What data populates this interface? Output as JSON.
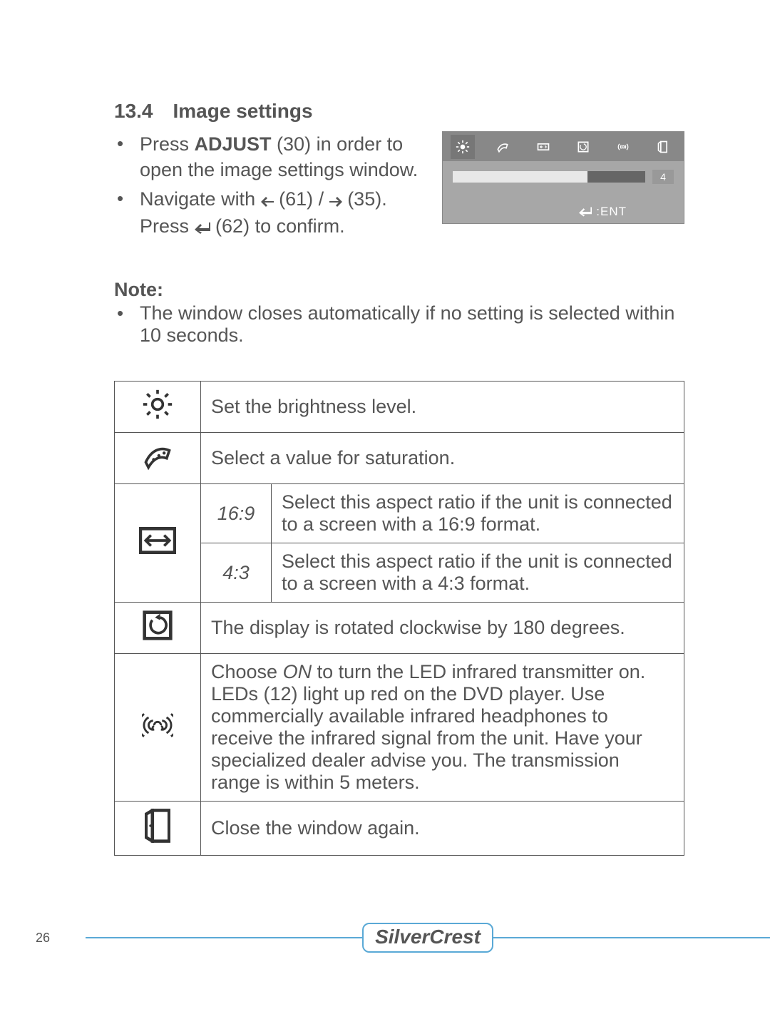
{
  "section": {
    "number": "13.4",
    "title": "Image settings"
  },
  "instructions": {
    "line1_pre": "Press ",
    "line1_bold": "ADJUST",
    "line1_post": " (30) in order to open the image settings window.",
    "line2_pre": "Navigate with ",
    "line2_mid1": " (61) ",
    "line2_slash": "/",
    "line2_mid2": " (35). Press ",
    "line2_post": " (62) to confirm."
  },
  "screenshot": {
    "value": "4",
    "footer_label": ":ENT"
  },
  "note": {
    "label": "Note:",
    "text": "The window closes automatically if no setting is selected within 10 seconds."
  },
  "table": {
    "brightness": "Set the brightness level.",
    "saturation": "Select a value for saturation.",
    "ratio_169_label": "16:9",
    "ratio_169_desc": "Select this aspect ratio if the unit is connected to a screen with a 16:9 format.",
    "ratio_43_label": "4:3",
    "ratio_43_desc": "Select this aspect ratio if the unit is connected to a screen with a 4:3 format.",
    "rotate": "The display is rotated clockwise by 180 degrees.",
    "ir_pre": "Choose ",
    "ir_on": "ON",
    "ir_post": " to turn the LED infrared transmitter on. LEDs (12) light up red on the DVD player. Use commercially available infrared headphones to receive the infrared signal from the unit. Have your specialized dealer advise you. The transmission range is within 5 meters.",
    "close": "Close the window again."
  },
  "footer": {
    "page": "26",
    "brand": "SilverCrest"
  }
}
